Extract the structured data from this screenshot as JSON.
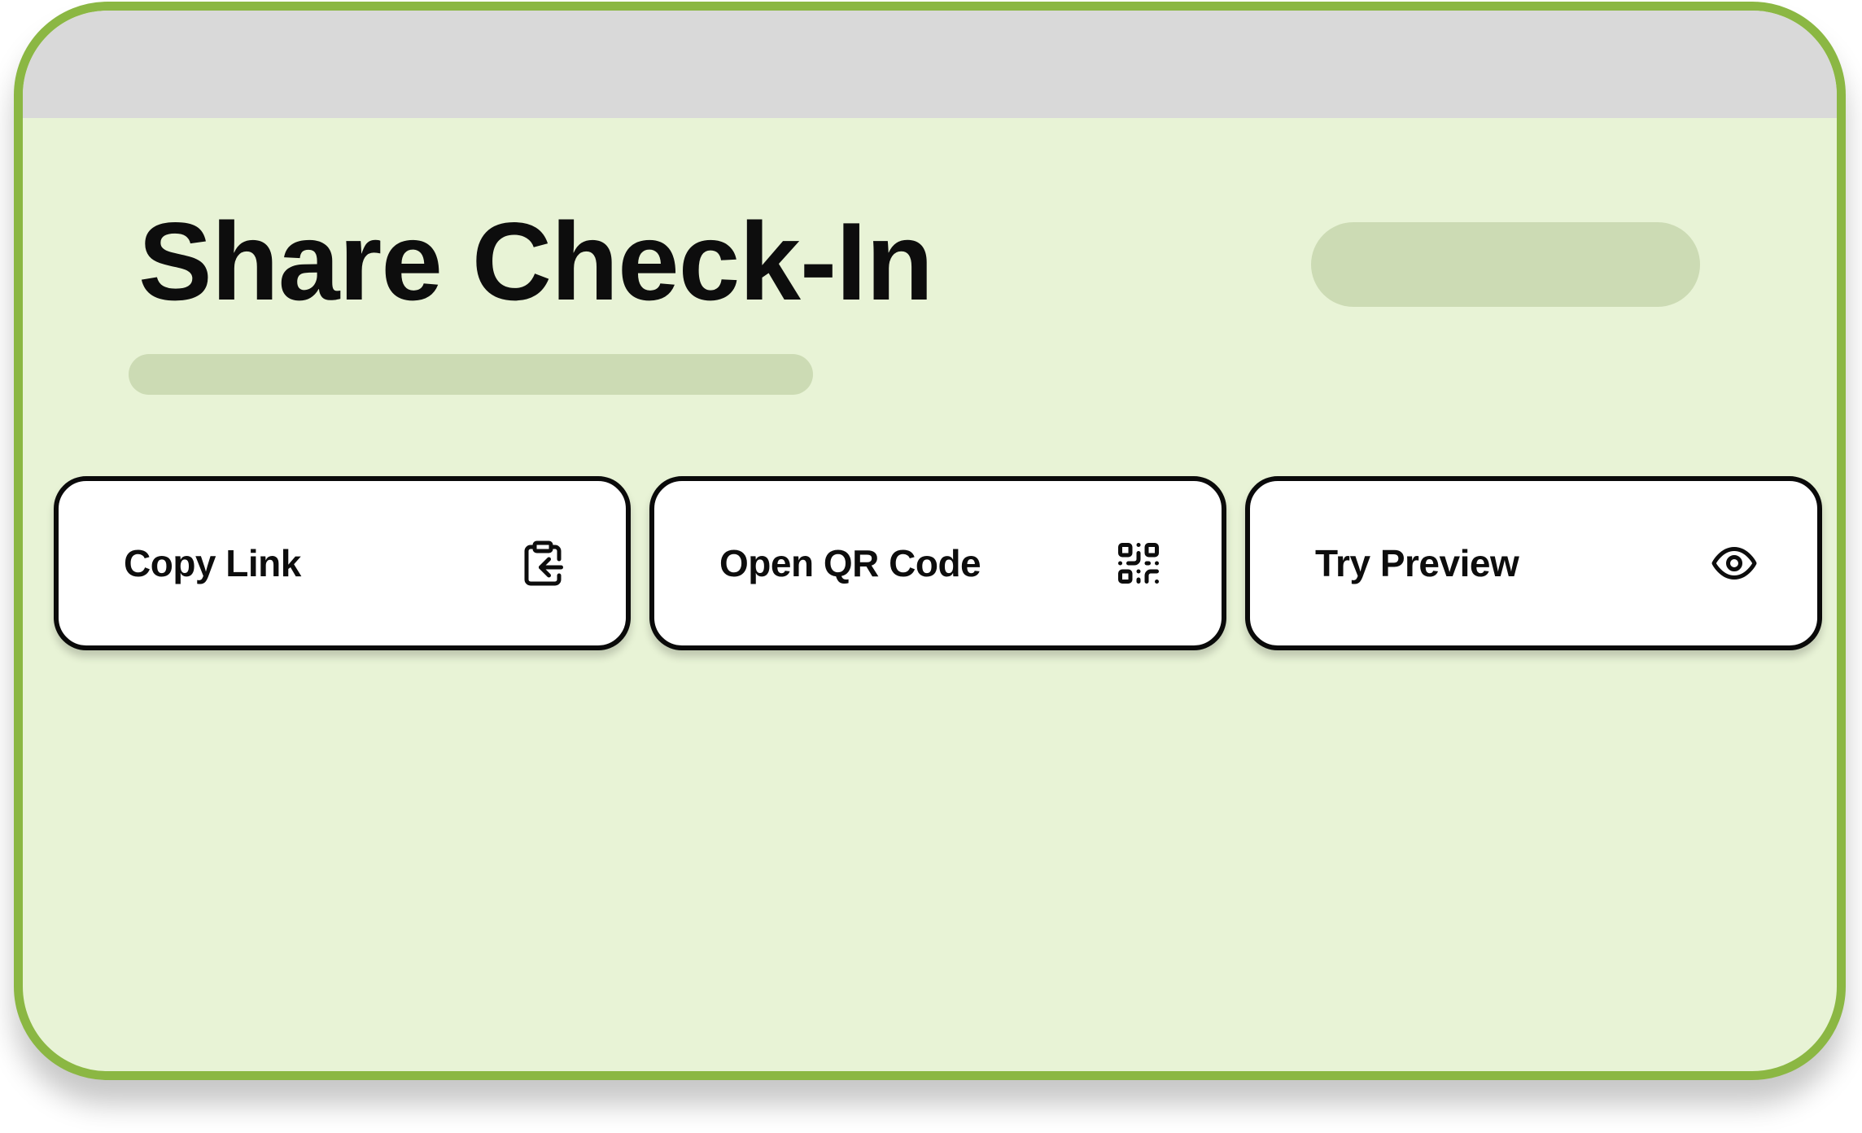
{
  "page": {
    "title": "Share Check-In"
  },
  "actions": [
    {
      "label": "Copy Link",
      "icon": "clipboard-copy-icon"
    },
    {
      "label": "Open QR Code",
      "icon": "qr-code-icon"
    },
    {
      "label": "Try Preview",
      "icon": "eye-icon"
    }
  ],
  "colors": {
    "frame_border": "#8bb743",
    "background": "#e8f3d6",
    "top_bar": "#d9d9d9",
    "placeholder": "#ccdbb4",
    "button_fill": "#ffffff",
    "button_border": "#0a0a0a",
    "text": "#0d0d0d"
  }
}
